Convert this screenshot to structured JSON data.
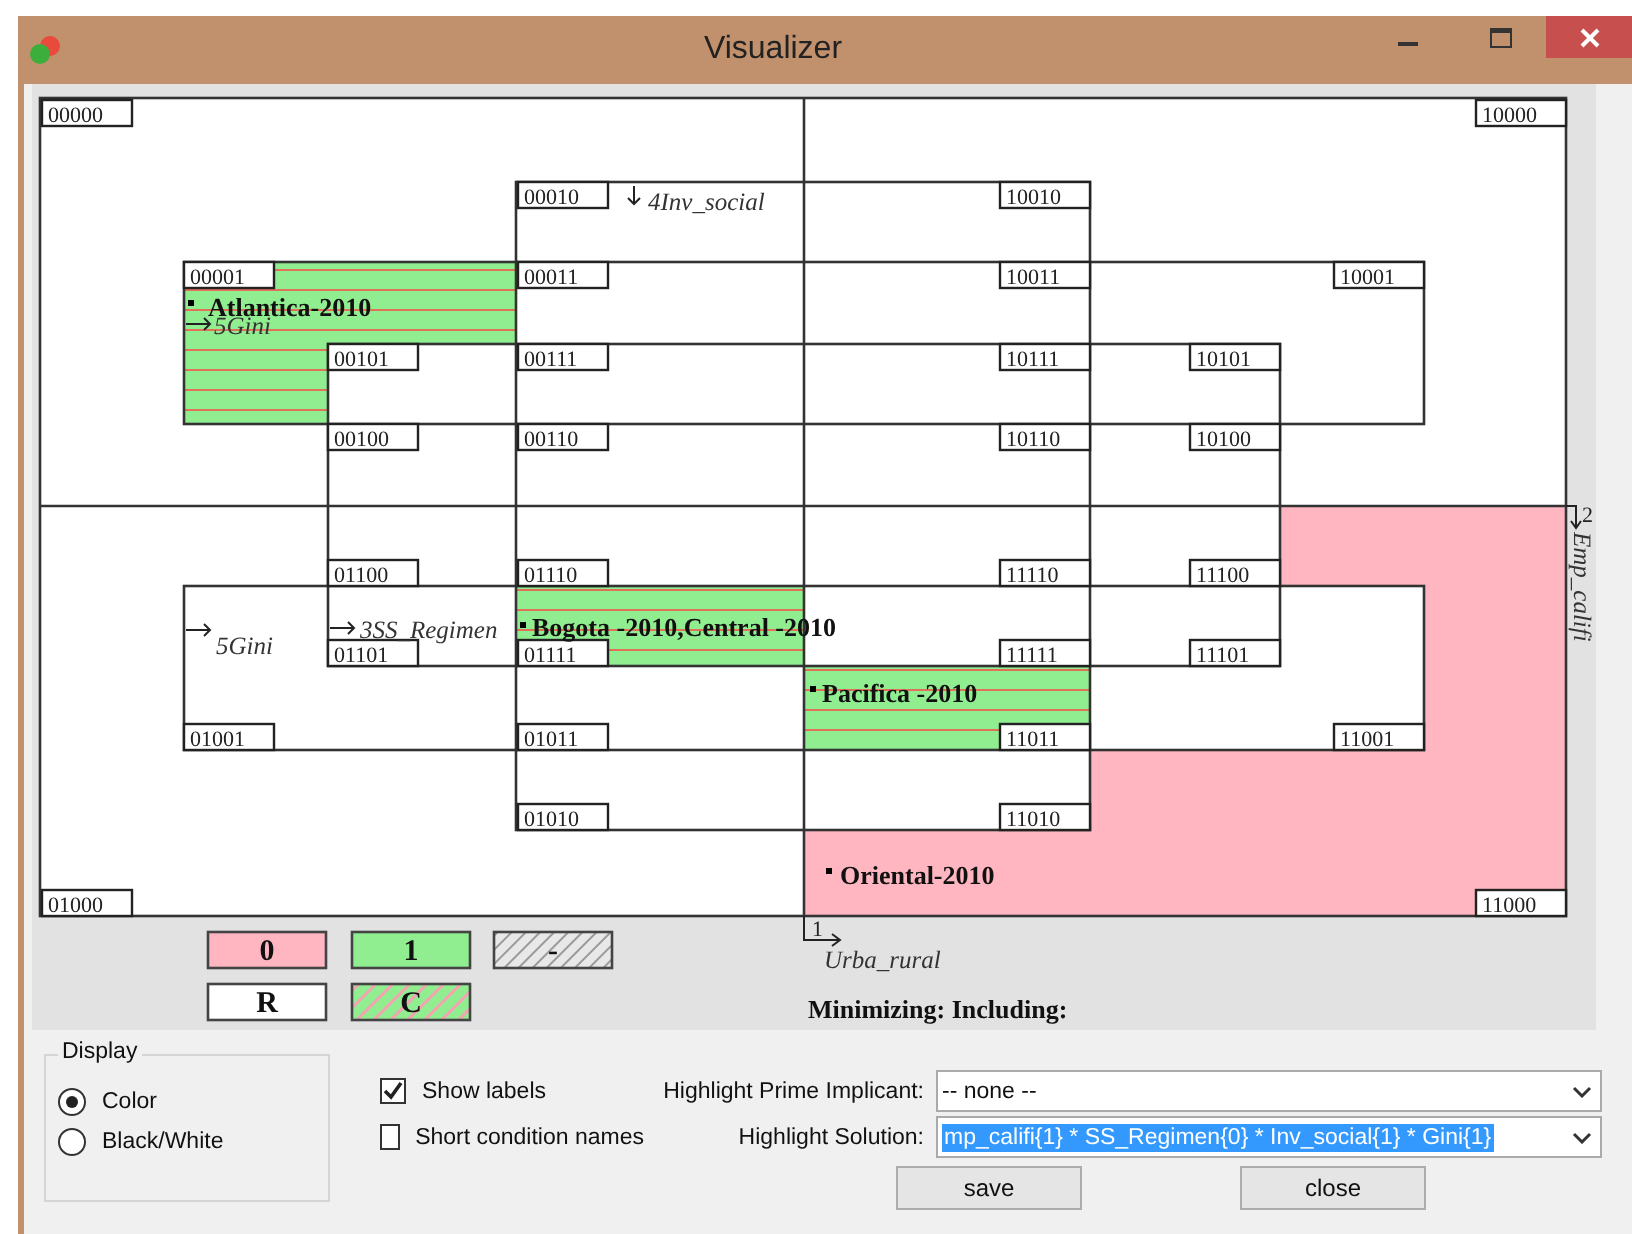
{
  "window": {
    "title": "Visualizer"
  },
  "cells": [
    "00000",
    "10000",
    "00010",
    "10010",
    "00001",
    "00011",
    "10011",
    "10001",
    "00101",
    "00111",
    "10111",
    "10101",
    "00100",
    "00110",
    "10110",
    "10100",
    "01100",
    "01110",
    "11110",
    "11100",
    "01101",
    "01111",
    "11111",
    "11101",
    "01001",
    "01011",
    "11011",
    "11001",
    "01010",
    "11010",
    "01000",
    "11000"
  ],
  "regions": [
    {
      "kind": "positive",
      "highlighted": true
    },
    {
      "kind": "positive",
      "highlighted": true
    },
    {
      "kind": "positive",
      "highlighted": true
    },
    {
      "kind": "negative",
      "highlighted": false
    }
  ],
  "cases": [
    "Atlantica-2010",
    "Bogota -2010,Central -2010",
    "Pacifica -2010",
    "Oriental-2010"
  ],
  "conditions": [
    "4Inv_social",
    "5Gini",
    "3SS_Regimen",
    "5Gini"
  ],
  "axes": [
    {
      "number": "1",
      "name": "Urba_rural"
    },
    {
      "number": "2",
      "name": "Emp_califi"
    }
  ],
  "legend": [
    {
      "label": "0",
      "kind": "negative"
    },
    {
      "label": "1",
      "kind": "positive"
    },
    {
      "label": "-",
      "kind": "dontcare"
    },
    {
      "label": "R",
      "kind": "remainder"
    },
    {
      "label": "C",
      "kind": "contradiction"
    }
  ],
  "status_text": "Minimizing: Including:",
  "display": {
    "title": "Display",
    "options": [
      {
        "label": "Color",
        "selected": true
      },
      {
        "label": "Black/White",
        "selected": false
      }
    ]
  },
  "checkboxes": [
    {
      "label": "Show labels",
      "checked": true
    },
    {
      "label": "Short condition names",
      "checked": false
    }
  ],
  "prime_implicant": {
    "label": "Highlight Prime Implicant:",
    "value": "-- none --"
  },
  "solution": {
    "label": "Highlight Solution:",
    "value": "mp_califi{1} * SS_Regimen{0} * Inv_social{1} * Gini{1}"
  },
  "buttons": [
    "save",
    "close"
  ]
}
